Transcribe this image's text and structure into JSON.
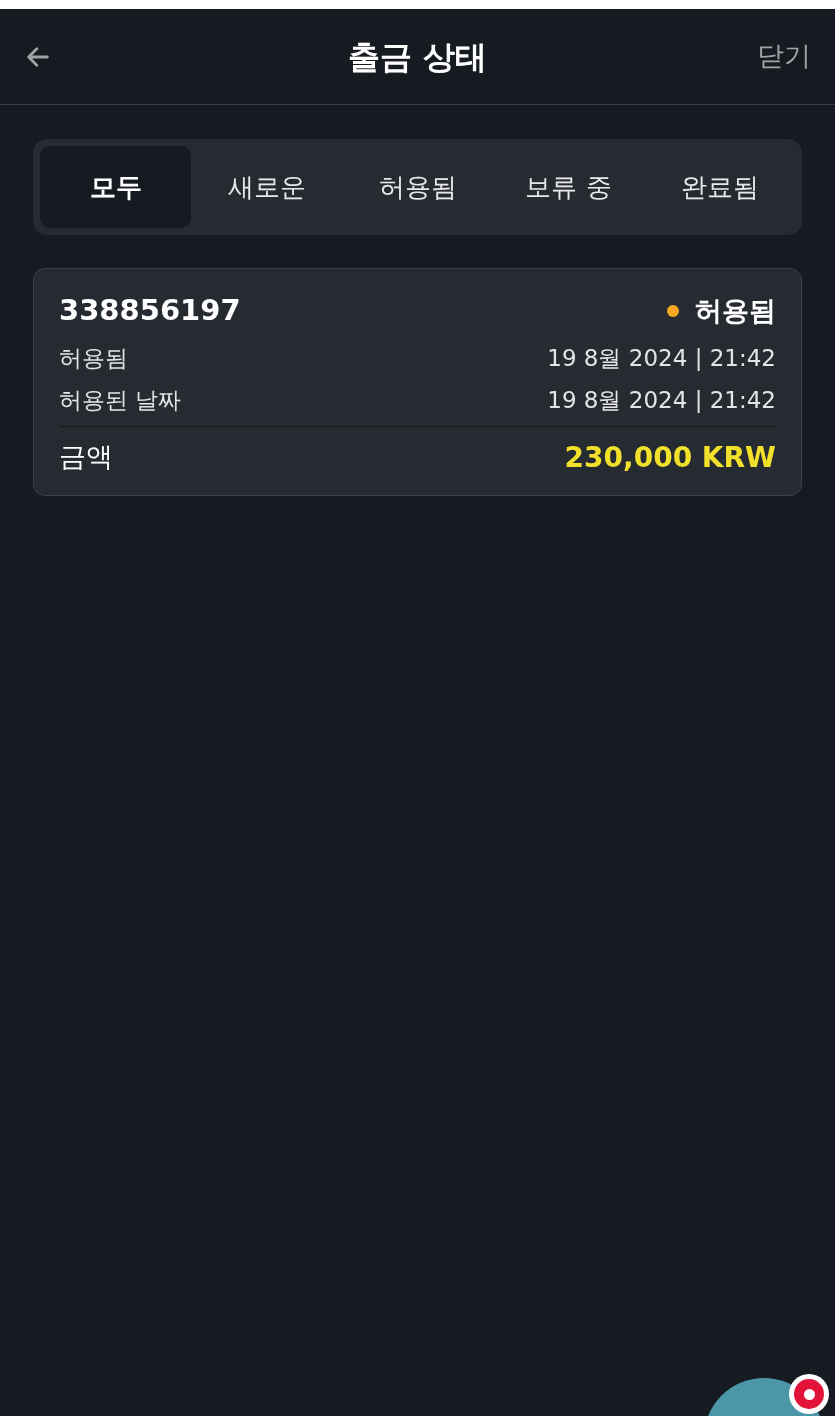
{
  "header": {
    "title": "출금 상태",
    "close": "닫기"
  },
  "tabs": [
    {
      "label": "모두",
      "selected": true
    },
    {
      "label": "새로운",
      "selected": false
    },
    {
      "label": "허용됨",
      "selected": false
    },
    {
      "label": "보류 중",
      "selected": false
    },
    {
      "label": "완료됨",
      "selected": false
    }
  ],
  "withdrawals": [
    {
      "id": "338856197",
      "status": {
        "label": "허용됨",
        "color": "#f5a623"
      },
      "rows": [
        {
          "label": "허용됨",
          "value": "19 8월 2024 | 21:42"
        },
        {
          "label": "허용된 날짜",
          "value": "19 8월 2024 | 21:42"
        }
      ],
      "amount_label": "금액",
      "amount": "230,000 KRW"
    }
  ]
}
